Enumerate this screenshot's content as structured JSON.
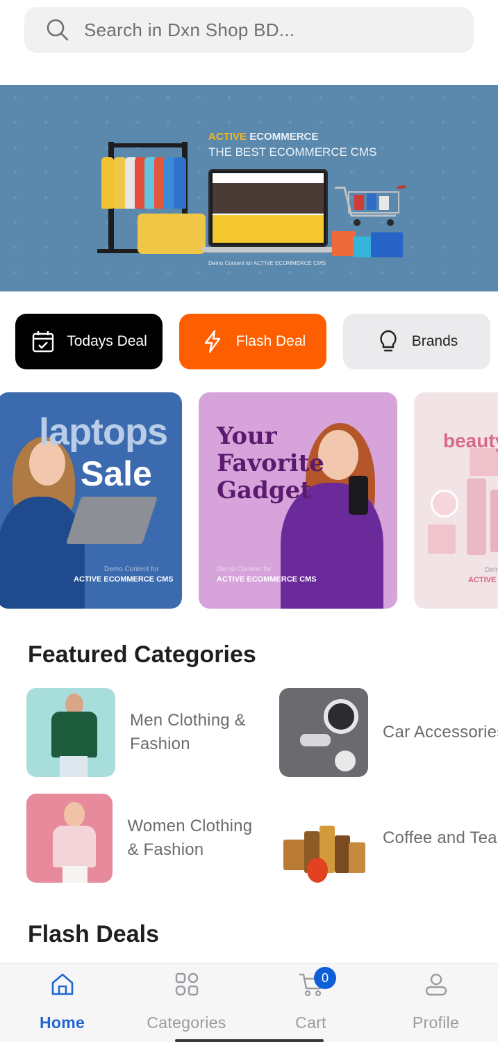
{
  "search": {
    "placeholder": "Search in Dxn Shop BD..."
  },
  "banner": {
    "brand_part1": "ACTIVE",
    "brand_part2": "ECOMMERCE",
    "tagline": "THE BEST ECOMMERCE CMS",
    "demo": "Demo Content for ACTIVE ECOMMERCE CMS"
  },
  "deals": [
    {
      "label": "Todays Deal",
      "icon": "calendar-check-icon"
    },
    {
      "label": "Flash Deal",
      "icon": "lightning-icon"
    },
    {
      "label": "Brands",
      "icon": "lightbulb-icon"
    }
  ],
  "promos": [
    {
      "line1": "laptops",
      "line2": "Sale",
      "demo": "Demo Content for",
      "brand": "ACTIVE ECOMMERCE CMS"
    },
    {
      "line1": "Your",
      "line2": "Favorite",
      "line3": "Gadget",
      "demo": "Demo Content for",
      "brand": "ACTIVE ECOMMERCE CMS"
    },
    {
      "line1": "beauty",
      "demo": "Dem",
      "brand": "ACTIVE"
    }
  ],
  "featured": {
    "title": "Featured Categories",
    "items": [
      {
        "name": "Men Clothing & Fashion"
      },
      {
        "name": "Car Accessories"
      },
      {
        "name": "Women Clothing & Fashion"
      },
      {
        "name": "Coffee and Tea"
      }
    ]
  },
  "flash": {
    "title": "Flash Deals"
  },
  "nav": {
    "items": [
      {
        "label": "Home",
        "icon": "home-icon"
      },
      {
        "label": "Categories",
        "icon": "grid-icon"
      },
      {
        "label": "Cart",
        "icon": "cart-icon"
      },
      {
        "label": "Profile",
        "icon": "person-icon"
      }
    ],
    "cart_count": "0"
  },
  "colors": {
    "accent": "#1f67cf",
    "flash": "#fd5e00",
    "banner": "#5b89ad"
  }
}
